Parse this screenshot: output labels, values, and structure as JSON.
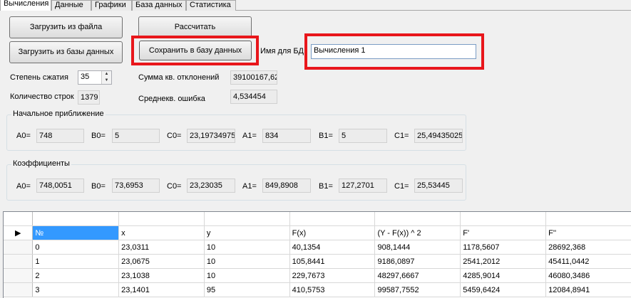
{
  "tabs": [
    "Вычисления",
    "Данные",
    "Графики",
    "База данных",
    "Статистика"
  ],
  "buttons": {
    "load_file": "Загрузить из файла",
    "calculate": "Рассчитать",
    "load_db": "Загрузить из базы данных",
    "save_db": "Сохранить в базу данных"
  },
  "db_name": {
    "label": "Имя для БД",
    "value": "Вычисления 1"
  },
  "compression": {
    "label": "Степень сжатия",
    "value": "35"
  },
  "row_count": {
    "label": "Количество строк",
    "value": "1379"
  },
  "sum_sq": {
    "label": "Сумма кв. отклонений",
    "value": "39100167,62"
  },
  "mean_err": {
    "label": "Среднекв. ошибка",
    "value": "4,534454"
  },
  "initial": {
    "title": "Начальное приближение",
    "A0": "748",
    "B0": "5",
    "C0": "23,19734975",
    "A1": "834",
    "B1": "5",
    "C1": "25,49435025"
  },
  "coeffs": {
    "title": "Коэффициенты",
    "A0": "748,0051",
    "B0": "73,6953",
    "C0": "23,23035",
    "A1": "849,8908",
    "B1": "127,2701",
    "C1": "25,53445"
  },
  "param_labels": {
    "A0": "A0=",
    "B0": "B0=",
    "C0": "C0=",
    "A1": "A1=",
    "B1": "B1=",
    "C1": "C1="
  },
  "table": {
    "headers": [
      "№",
      "x",
      "y",
      "F(x)",
      "(Y - F(x)) ^ 2",
      "F'",
      "F''"
    ],
    "rows": [
      [
        "0",
        "23,0311",
        "10",
        "40,1354",
        "908,1444",
        "1178,5607",
        "28692,368"
      ],
      [
        "1",
        "23,0675",
        "10",
        "105,8441",
        "9186,0897",
        "2541,2012",
        "45411,0442"
      ],
      [
        "2",
        "23,1038",
        "10",
        "229,7673",
        "48297,6667",
        "4285,9014",
        "46080,3486"
      ],
      [
        "3",
        "23,1401",
        "95",
        "410,5753",
        "99587,7552",
        "5459,6424",
        "12084,8941"
      ]
    ]
  },
  "colors": {
    "highlight": "#e8161b",
    "selection": "#3399ff"
  }
}
